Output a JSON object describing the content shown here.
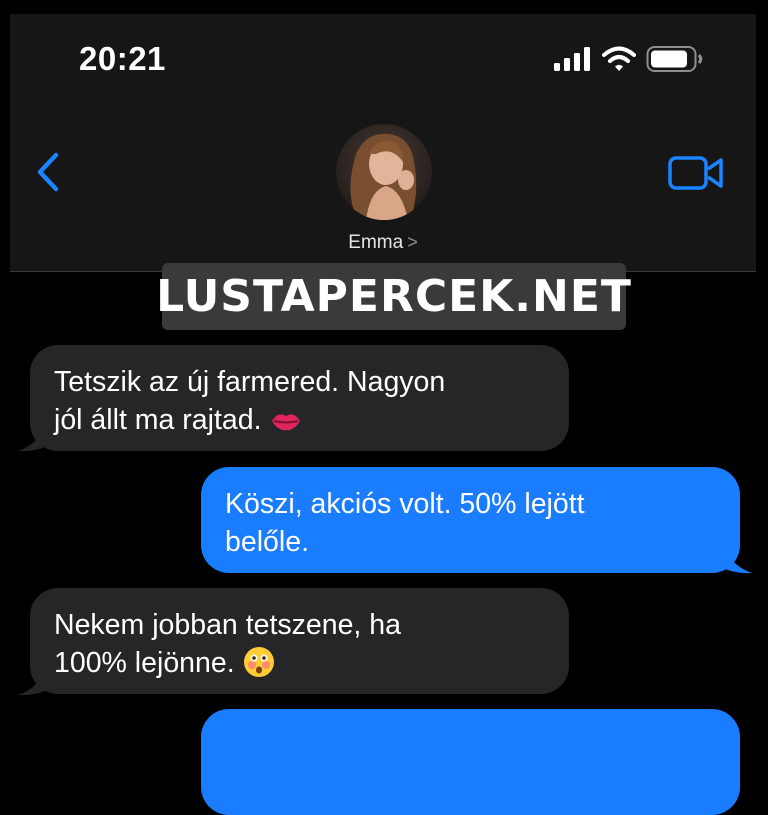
{
  "status_bar": {
    "time": "20:21",
    "icons": [
      "signal-icon",
      "wifi-icon",
      "battery-icon"
    ]
  },
  "nav": {
    "back_icon": "chevron-left-icon",
    "video_icon": "video-camera-icon",
    "contact_name": "Emma",
    "contact_chevron": ">"
  },
  "watermark": {
    "text": "LUSTAPERCEK.NET"
  },
  "messages": [
    {
      "direction": "incoming",
      "text_line1": "Tetszik az új farmered. Nagyon",
      "text_line2": "jól állt ma rajtad.",
      "emoji": "lips-emoji"
    },
    {
      "direction": "outgoing",
      "text_line1": "Köszi, akciós volt. 50% lejött",
      "text_line2": "belőle."
    },
    {
      "direction": "incoming",
      "text_line1": "Nekem jobban tetszene, ha",
      "text_line2": "100% lejönne.",
      "emoji": "flushed-face-emoji"
    },
    {
      "direction": "outgoing",
      "text_line1": "",
      "text_line2": ""
    }
  ],
  "colors": {
    "background": "#000000",
    "header": "#161616",
    "incoming_bubble": "#262628",
    "outgoing_bubble": "#1a7cff",
    "accent": "#1a84ff"
  }
}
